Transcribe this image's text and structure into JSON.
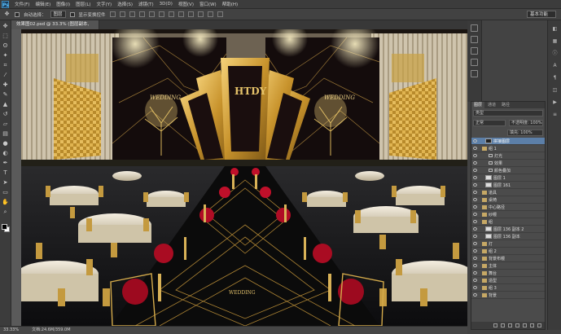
{
  "app": {
    "logo": "Ps"
  },
  "menu": [
    "文件(F)",
    "编辑(E)",
    "图像(I)",
    "图层(L)",
    "文字(Y)",
    "选择(S)",
    "滤镜(T)",
    "3D(D)",
    "视图(V)",
    "窗口(W)",
    "帮助(H)"
  ],
  "options": {
    "auto_select_label": "自动选择：",
    "auto_select_value": "图层",
    "transform_label": "显示变换控件",
    "workspace": "基本功能"
  },
  "document": {
    "tab_title": "效果图02.psd @ 33.3% (图层副本, RGB/8)"
  },
  "status": {
    "zoom": "33.33%",
    "doc_size": "文档:24.6M/359.0M"
  },
  "scene": {
    "monogram": "HTDY",
    "left_script": "WEDDING",
    "right_script": "WEDDING",
    "floor_text": "WEDDING"
  },
  "layers": {
    "tabs": [
      "图层",
      "通道",
      "路径"
    ],
    "kind_filter": "类型",
    "blend_mode": "正常",
    "opacity_label": "不透明度: 100%",
    "fill_label": "填充: 100%",
    "rows": [
      {
        "name": "拼接图层",
        "selected": true,
        "kind": "layer"
      },
      {
        "name": "组 1",
        "kind": "group"
      },
      {
        "name": "灯光",
        "kind": "fx"
      },
      {
        "name": "效果",
        "kind": "fx"
      },
      {
        "name": "颜色叠加",
        "kind": "fx"
      },
      {
        "name": "图层 1",
        "kind": "layer"
      },
      {
        "name": "图层 161",
        "kind": "layer"
      },
      {
        "name": "道具",
        "kind": "group"
      },
      {
        "name": "桌椅",
        "kind": "group"
      },
      {
        "name": "中心路径",
        "kind": "group"
      },
      {
        "name": "纱幔",
        "kind": "group"
      },
      {
        "name": "组",
        "kind": "group"
      },
      {
        "name": "图层 136 副本 2",
        "kind": "layer"
      },
      {
        "name": "图层 136 副本",
        "kind": "layer"
      },
      {
        "name": "灯",
        "kind": "group"
      },
      {
        "name": "组 2",
        "kind": "group"
      },
      {
        "name": "背景布幔",
        "kind": "group"
      },
      {
        "name": "主体",
        "kind": "group"
      },
      {
        "name": "舞台",
        "kind": "group"
      },
      {
        "name": "造型",
        "kind": "group"
      },
      {
        "name": "组 3",
        "kind": "group"
      },
      {
        "name": "背景",
        "kind": "group"
      }
    ]
  },
  "colors": {
    "gold": "#d4a53a",
    "dark": "#120b0b",
    "rose": "#c0102a",
    "cloth": "#ede5d2"
  }
}
